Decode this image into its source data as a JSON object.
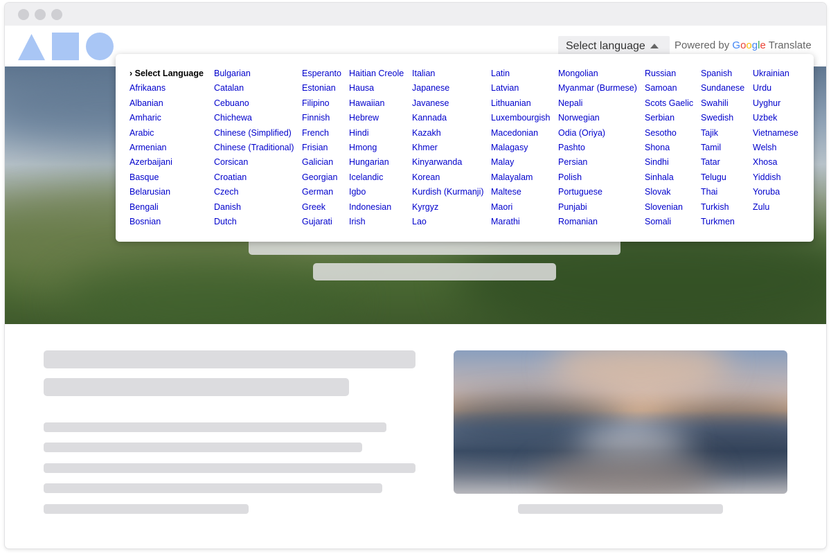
{
  "header": {
    "language_select_label": "Select language",
    "powered_by_label": "Powered by",
    "google_letters": [
      "G",
      "o",
      "o",
      "g",
      "l",
      "e"
    ],
    "translate_label": "Translate"
  },
  "colors": {
    "logo": "#a9c6f5",
    "link": "#0000cc",
    "skeleton": "#dcdcdf",
    "google_blue": "#4285F4",
    "google_red": "#EA4335",
    "google_yellow": "#FBBC05",
    "google_green": "#34A853"
  },
  "icons": {
    "logo": [
      "triangle-shape-icon",
      "square-shape-icon",
      "circle-shape-icon"
    ],
    "dropdown_caret": "caret-up-icon"
  },
  "language_menu": {
    "columns": [
      [
        "› Select Language",
        "Afrikaans",
        "Albanian",
        "Amharic",
        "Arabic",
        "Armenian",
        "Azerbaijani",
        "Basque",
        "Belarusian",
        "Bengali",
        "Bosnian"
      ],
      [
        "Bulgarian",
        "Catalan",
        "Cebuano",
        "Chichewa",
        "Chinese (Simplified)",
        "Chinese (Traditional)",
        "Corsican",
        "Croatian",
        "Czech",
        "Danish",
        "Dutch"
      ],
      [
        "Esperanto",
        "Estonian",
        "Filipino",
        "Finnish",
        "French",
        "Frisian",
        "Galician",
        "Georgian",
        "German",
        "Greek",
        "Gujarati"
      ],
      [
        "Haitian Creole",
        "Hausa",
        "Hawaiian",
        "Hebrew",
        "Hindi",
        "Hmong",
        "Hungarian",
        "Icelandic",
        "Igbo",
        "Indonesian",
        "Irish"
      ],
      [
        "Italian",
        "Japanese",
        "Javanese",
        "Kannada",
        "Kazakh",
        "Khmer",
        "Kinyarwanda",
        "Korean",
        "Kurdish (Kurmanji)",
        "Kyrgyz",
        "Lao"
      ],
      [
        "Latin",
        "Latvian",
        "Lithuanian",
        "Luxembourgish",
        "Macedonian",
        "Malagasy",
        "Malay",
        "Malayalam",
        "Maltese",
        "Maori",
        "Marathi"
      ],
      [
        "Mongolian",
        "Myanmar (Burmese)",
        "Nepali",
        "Norwegian",
        "Odia (Oriya)",
        "Pashto",
        "Persian",
        "Polish",
        "Portuguese",
        "Punjabi",
        "Romanian"
      ],
      [
        "Russian",
        "Samoan",
        "Scots Gaelic",
        "Serbian",
        "Sesotho",
        "Shona",
        "Sindhi",
        "Sinhala",
        "Slovak",
        "Slovenian",
        "Somali"
      ],
      [
        "Spanish",
        "Sundanese",
        "Swahili",
        "Swedish",
        "Tajik",
        "Tamil",
        "Tatar",
        "Telugu",
        "Thai",
        "Turkish",
        "Turkmen"
      ],
      [
        "Ukrainian",
        "Urdu",
        "Uyghur",
        "Uzbek",
        "Vietnamese",
        "Welsh",
        "Xhosa",
        "Yiddish",
        "Yoruba",
        "Zulu"
      ]
    ]
  }
}
